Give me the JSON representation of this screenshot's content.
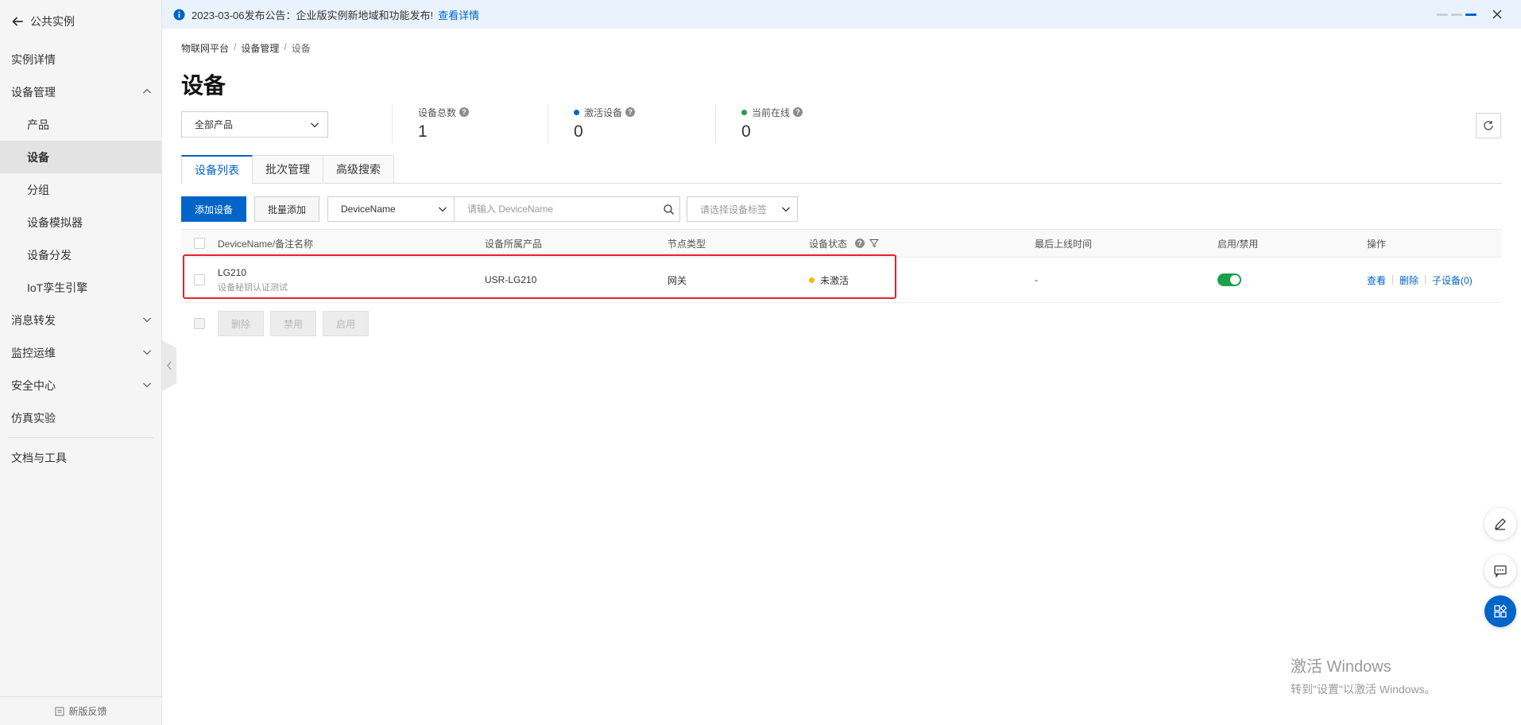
{
  "sidebar": {
    "back_label": "公共实例",
    "items": [
      {
        "label": "实例详情"
      },
      {
        "label": "设备管理"
      },
      {
        "label": "产品"
      },
      {
        "label": "设备"
      },
      {
        "label": "分组"
      },
      {
        "label": "设备模拟器"
      },
      {
        "label": "设备分发"
      },
      {
        "label": "IoT孪生引擎"
      },
      {
        "label": "消息转发"
      },
      {
        "label": "监控运维"
      },
      {
        "label": "安全中心"
      },
      {
        "label": "仿真实验"
      },
      {
        "label": "文档与工具"
      }
    ],
    "feedback_label": "新版反馈"
  },
  "notice": {
    "text": "2023-03-06发布公告：企业版实例新地域和功能发布!",
    "link_label": "查看详情"
  },
  "breadcrumb": [
    "物联网平台",
    "设备管理",
    "设备"
  ],
  "page_title": "设备",
  "product_select": {
    "value": "全部产品"
  },
  "stats": {
    "total": {
      "label": "设备总数",
      "value": "1"
    },
    "activated": {
      "label": "激活设备",
      "value": "0"
    },
    "online": {
      "label": "当前在线",
      "value": "0"
    }
  },
  "tabs": [
    {
      "label": "设备列表"
    },
    {
      "label": "批次管理"
    },
    {
      "label": "高级搜索"
    }
  ],
  "toolbar": {
    "add_label": "添加设备",
    "batch_add_label": "批量添加",
    "search_field": "DeviceName",
    "search_placeholder": "请输入 DeviceName",
    "tag_placeholder": "请选择设备标签"
  },
  "table": {
    "columns": [
      "DeviceName/备注名称",
      "设备所属产品",
      "节点类型",
      "设备状态",
      "最后上线时间",
      "启用/禁用",
      "操作"
    ],
    "rows": [
      {
        "name": "LG210",
        "remark": "设备秘钥认证测试",
        "product": "USR-LG210",
        "node_type": "网关",
        "status": "未激活",
        "last_online": "-",
        "enabled": true,
        "ops": {
          "view": "查看",
          "delete": "删除",
          "subdevices": "子设备(0)"
        }
      }
    ]
  },
  "bulk_actions": {
    "delete": "删除",
    "disable": "禁用",
    "enable": "启用"
  },
  "watermark": {
    "line1": "激活 Windows",
    "line2": "转到\"设置\"以激活 Windows。"
  },
  "colors": {
    "primary": "#0064c8",
    "status_inactive": "#f5b800",
    "activated_dot": "#0064c8",
    "online_dot": "#1a9f4b",
    "toggle_on": "#1a9f4b",
    "highlight": "#e3232a"
  },
  "icons": {
    "back": "arrow-left-icon",
    "collapse": "chevron-up-icon",
    "expand": "chevron-down-icon",
    "info": "info-icon",
    "help": "question-icon",
    "filter": "filter-icon",
    "refresh": "refresh-icon",
    "search": "search-icon",
    "edit": "edit-icon",
    "chat": "chat-icon",
    "apps": "apps-icon"
  }
}
